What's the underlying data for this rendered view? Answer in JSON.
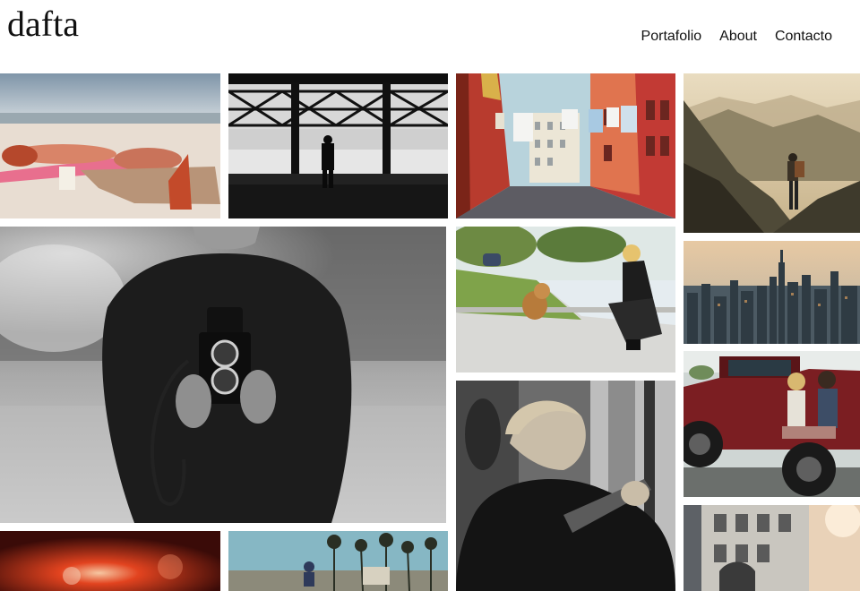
{
  "site": {
    "logo": "dafta"
  },
  "nav": [
    {
      "label": "Portafolio"
    },
    {
      "label": "About"
    },
    {
      "label": "Contacto"
    }
  ],
  "gallery": {
    "photos": [
      {
        "subject": "women-sunbathing-on-beach"
      },
      {
        "subject": "silhouette-in-industrial-window"
      },
      {
        "subject": "street-with-hanging-laundry"
      },
      {
        "subject": "hiker-on-mountain-ridge"
      },
      {
        "subject": "man-holding-twin-lens-camera"
      },
      {
        "subject": "woman-with-bulldog-on-sidewalk"
      },
      {
        "subject": "city-skyline-at-sunset"
      },
      {
        "subject": "man-with-guitar-black-and-white"
      },
      {
        "subject": "women-on-red-offroad-truck"
      },
      {
        "subject": "red-bokeh-lights"
      },
      {
        "subject": "person-on-bike-under-palm-trees"
      },
      {
        "subject": "ornate-building-facade"
      }
    ]
  }
}
